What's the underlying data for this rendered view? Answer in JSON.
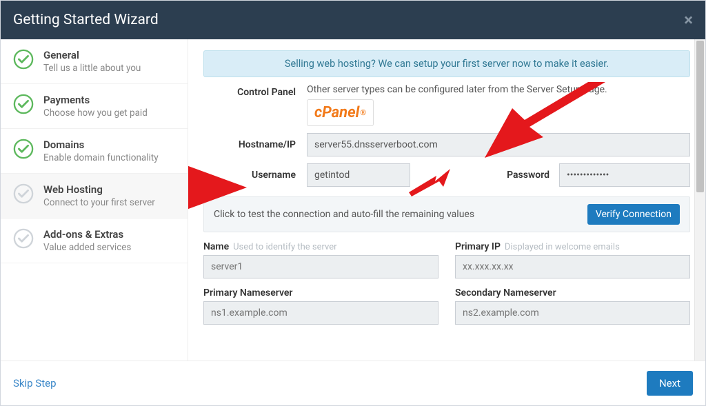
{
  "header": {
    "title": "Getting Started Wizard",
    "close_glyph": "×"
  },
  "sidebar": {
    "steps": [
      {
        "title": "General",
        "sub": "Tell us a little about you",
        "done": true
      },
      {
        "title": "Payments",
        "sub": "Choose how you get paid",
        "done": true
      },
      {
        "title": "Domains",
        "sub": "Enable domain functionality",
        "done": true
      },
      {
        "title": "Web Hosting",
        "sub": "Connect to your first server",
        "done": false
      },
      {
        "title": "Add-ons & Extras",
        "sub": "Value added services",
        "done": false
      }
    ]
  },
  "banner": "Selling web hosting? We can setup your first server now to make it easier.",
  "form": {
    "control_panel_label": "Control Panel",
    "hint_other_servers": "Other server types can be configured later from the Server Setup page.",
    "cpanel_logo_text": "cPanel",
    "hostname_label": "Hostname/IP",
    "hostname_value": "server55.dnsserverboot.com",
    "username_label": "Username",
    "username_value": "getintod",
    "password_label": "Password",
    "password_value": "•••••••••••••"
  },
  "verify": {
    "text": "Click to test the connection and auto-fill the remaining values",
    "button": "Verify Connection"
  },
  "lower": {
    "name_label": "Name",
    "name_hint": "Used to identify the server",
    "name_placeholder": "server1",
    "primaryip_label": "Primary IP",
    "primaryip_hint": "Displayed in welcome emails",
    "primaryip_placeholder": "xx.xxx.xx.xx",
    "ns1_label": "Primary Nameserver",
    "ns1_placeholder": "ns1.example.com",
    "ns2_label": "Secondary Nameserver",
    "ns2_placeholder": "ns2.example.com"
  },
  "footer": {
    "skip": "Skip Step",
    "next": "Next"
  }
}
